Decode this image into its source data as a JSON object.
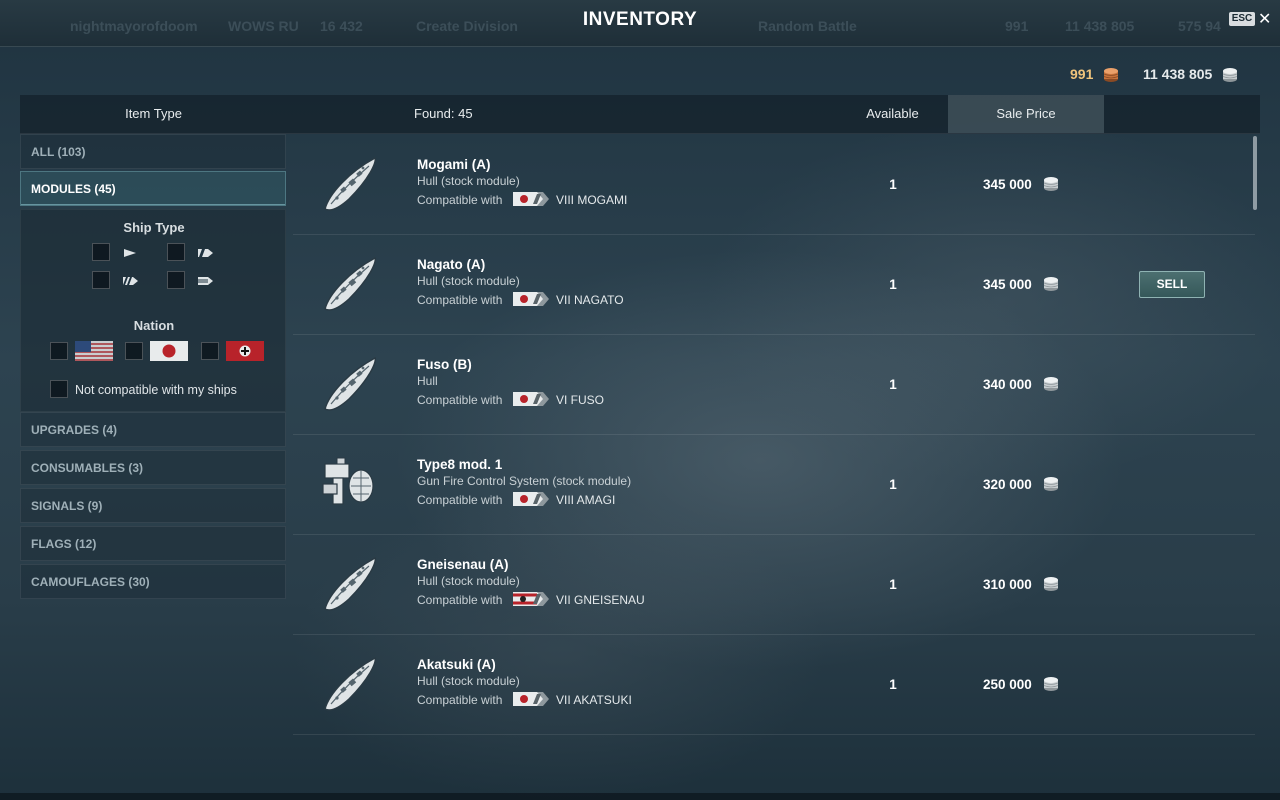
{
  "window": {
    "title": "INVENTORY",
    "esc_label": "ESC",
    "close_label": "✕"
  },
  "topbar_ghost": {
    "player": "nightmayorofdoom",
    "server": "WOWS RU",
    "number": "16 432",
    "division": "Create Division",
    "battle": "Random Battle",
    "gold": "991",
    "credits": "11 438 805",
    "free_xp": "575 94"
  },
  "balance": {
    "doubloons": "991",
    "credits": "11 438 805"
  },
  "header": {
    "item_type": "Item Type",
    "found": "Found: 45",
    "available": "Available",
    "sale_price": "Sale Price"
  },
  "categories": [
    {
      "label": "ALL (103)",
      "active": false
    },
    {
      "label": "MODULES (45)",
      "active": true
    },
    {
      "label": "UPGRADES (4)",
      "active": false
    },
    {
      "label": "CONSUMABLES (3)",
      "active": false
    },
    {
      "label": "SIGNALS (9)",
      "active": false
    },
    {
      "label": "FLAGS (12)",
      "active": false
    },
    {
      "label": "CAMOUFLAGES (30)",
      "active": false
    }
  ],
  "filters": {
    "ship_type_title": "Ship Type",
    "ship_types": [
      "destroyer-icon",
      "cruiser-icon",
      "battleship-icon",
      "aircraft-carrier-icon"
    ],
    "nation_title": "Nation",
    "nations": [
      "usa-flag",
      "japan-flag",
      "germany-flag"
    ],
    "not_compatible_label": "Not compatible with my ships"
  },
  "compatible_label": "Compatible with",
  "items": [
    {
      "name": "Mogami (A)",
      "type": "Hull (stock module)",
      "nation": "japan",
      "ship": "VIII MOGAMI",
      "available": "1",
      "price": "345 000",
      "icon": "hull-icon"
    },
    {
      "name": "Nagato (A)",
      "type": "Hull (stock module)",
      "nation": "japan",
      "ship": "VII NAGATO",
      "available": "1",
      "price": "345 000",
      "icon": "hull-icon",
      "sell": "SELL"
    },
    {
      "name": "Fuso (B)",
      "type": "Hull",
      "nation": "japan",
      "ship": "VI FUSO",
      "available": "1",
      "price": "340 000",
      "icon": "hull-icon"
    },
    {
      "name": "Type8 mod. 1",
      "type": "Gun Fire Control System (stock module)",
      "nation": "japan",
      "ship": "VIII AMAGI",
      "available": "1",
      "price": "320 000",
      "icon": "fire-control-icon"
    },
    {
      "name": "Gneisenau (A)",
      "type": "Hull (stock module)",
      "nation": "germany",
      "ship": "VII GNEISENAU",
      "available": "1",
      "price": "310 000",
      "icon": "hull-icon"
    },
    {
      "name": "Akatsuki (A)",
      "type": "Hull (stock module)",
      "nation": "japan",
      "ship": "VII AKATSUKI",
      "available": "1",
      "price": "250 000",
      "icon": "hull-icon"
    }
  ],
  "colors": {
    "doubloon": "#f0c47c",
    "accent": "#4c6f70"
  }
}
